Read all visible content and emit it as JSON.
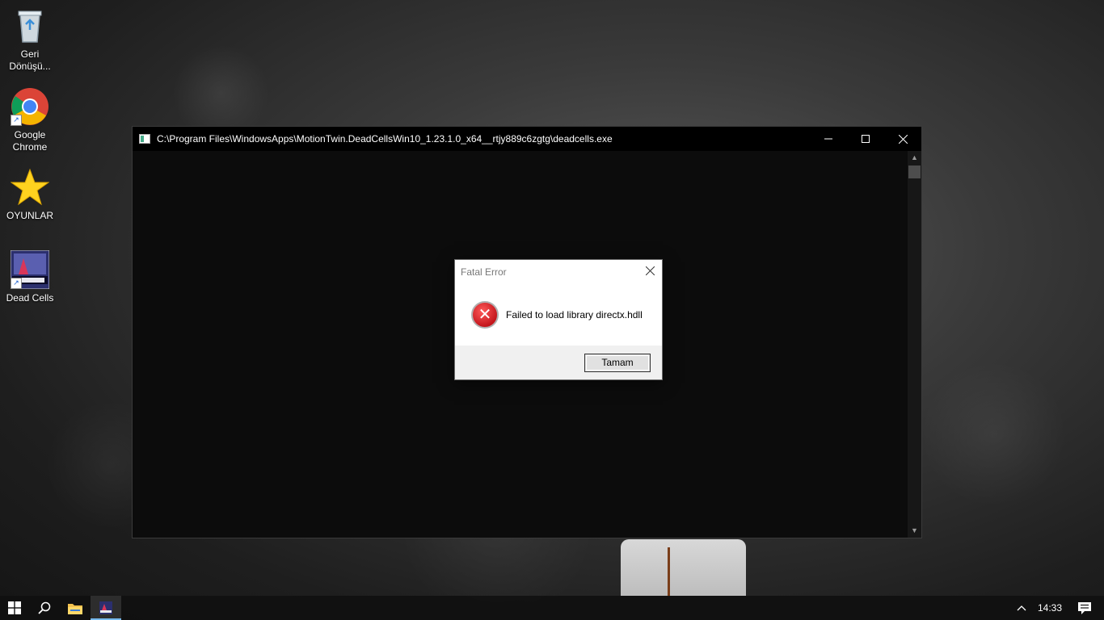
{
  "desktop": {
    "icons": [
      {
        "label_line1": "Geri",
        "label_line2": "Dönüşü...",
        "icon": "recycle-bin-icon"
      },
      {
        "label_line1": "Google",
        "label_line2": "Chrome",
        "icon": "chrome-icon"
      },
      {
        "label_line1": "OYUNLAR",
        "label_line2": "",
        "icon": "star-folder-icon"
      },
      {
        "label_line1": "Dead Cells",
        "label_line2": "",
        "icon": "dead-cells-icon"
      }
    ]
  },
  "console": {
    "title": "C:\\Program Files\\WindowsApps\\MotionTwin.DeadCellsWin10_1.23.1.0_x64__rtjy889c6zgtg\\deadcells.exe"
  },
  "dialog": {
    "title": "Fatal Error",
    "message": "Failed to load library directx.hdll",
    "ok_label": "Tamam"
  },
  "taskbar": {
    "clock": "14:33"
  },
  "colors": {
    "console_bg": "#0c0c0c",
    "error_red": "#c4161c",
    "taskbar_accent": "#76b9ed"
  }
}
